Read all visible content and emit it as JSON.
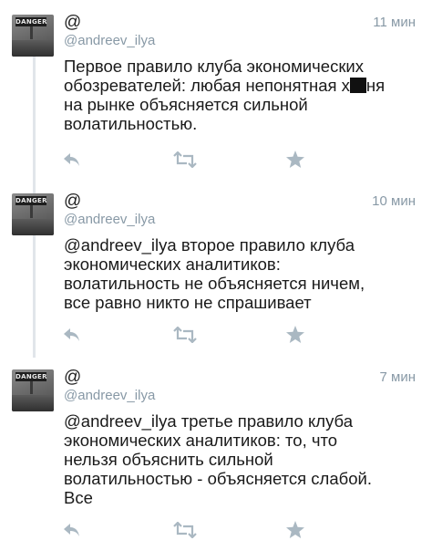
{
  "tweets": [
    {
      "avatar_sign": "DANGER",
      "name": "@",
      "handle": "@andreev_ilya",
      "time": "11 мин",
      "text_before": "Первое правило клуба экономических\nобозревателей: любая непонятная х",
      "text_after": "ня\nна рынке объясняется сильной\nволатильностью."
    },
    {
      "avatar_sign": "DANGER",
      "name": "@",
      "handle": "@andreev_ilya",
      "time": "10 мин",
      "text": "@andreev_ilya второе правило клуба\nэкономических аналитиков:\nволатильность не объясняется ничем,\nвсе равно никто не спрашивает"
    },
    {
      "avatar_sign": "DANGER",
      "name": "@",
      "handle": "@andreev_ilya",
      "time": "7 мин",
      "text": "@andreev_ilya третье правило клуба\nэкономических аналитиков: то, что\nнельзя объяснить сильной\nволатильностью - объясняется слабой.\nВсе"
    }
  ],
  "icons": {
    "reply": "reply-icon",
    "retweet": "retweet-icon",
    "favorite": "star-icon"
  },
  "colors": {
    "icon": "#aab8c2",
    "meta": "#8899a6",
    "text": "#1a1a1a"
  }
}
